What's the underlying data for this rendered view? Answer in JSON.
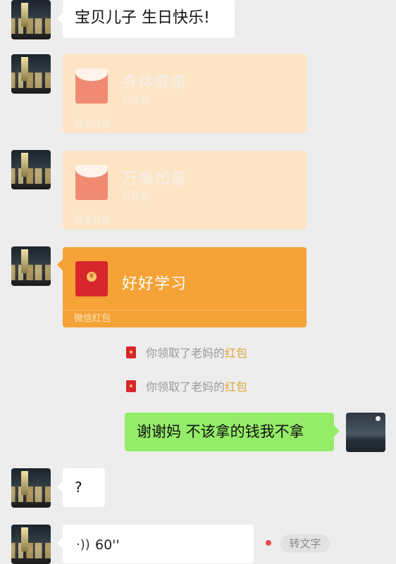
{
  "messages": [
    {
      "kind": "text",
      "text": "宝贝儿子 生日快乐!"
    },
    {
      "kind": "red_packet",
      "title": "身体健康",
      "status": "已领取",
      "footer": "微信红包"
    },
    {
      "kind": "red_packet",
      "title": "万事如意",
      "status": "已领取",
      "footer": "微信红包"
    },
    {
      "kind": "red_packet",
      "title": "好好学习",
      "footer": "微信红包"
    },
    {
      "kind": "notice",
      "prefix": "你领取了老妈的",
      "highlight": "红包"
    },
    {
      "kind": "notice",
      "prefix": "你领取了老妈的",
      "highlight": "红包"
    },
    {
      "kind": "text",
      "text": "谢谢妈 不该拿的钱我不拿"
    },
    {
      "kind": "text",
      "text": "?"
    },
    {
      "kind": "voice",
      "icon": "voice-wave-icon",
      "duration": "60''",
      "transcribe_label": "转文字"
    }
  ],
  "colors": {
    "background": "#ededed",
    "sent_bubble": "#95ec69",
    "received_bubble": "#ffffff",
    "red_packet_active": "#f5a236",
    "red_packet_opened": "#fde4c4",
    "highlight": "#e0a53a",
    "unread_dot": "#e5484d"
  }
}
